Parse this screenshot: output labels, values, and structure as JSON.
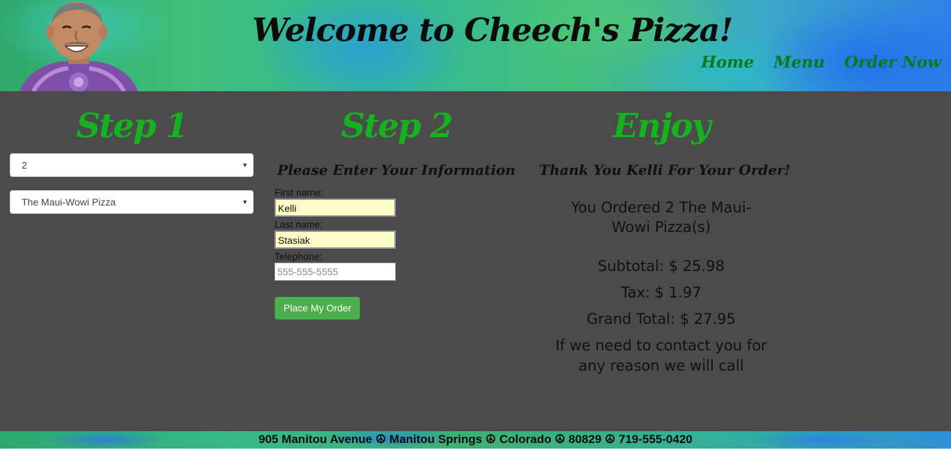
{
  "header": {
    "title": "Welcome to Cheech's Pizza!",
    "nav": {
      "home": "Home",
      "menu": "Menu",
      "order_now": "Order Now"
    }
  },
  "step1": {
    "heading": "Step 1",
    "quantity_value": "2",
    "pizza_value": "The Maui-Wowi Pizza"
  },
  "step2": {
    "heading": "Step 2",
    "subheading": "Please Enter Your Information",
    "first_name_label": "First name:",
    "first_name_value": "Kelli",
    "last_name_label": "Last name:",
    "last_name_value": "Stasiak",
    "telephone_label": "Telephone:",
    "telephone_placeholder": "555-555-5555",
    "button_label": "Place My Order"
  },
  "enjoy": {
    "heading": "Enjoy",
    "thanks": "Thank You Kelli For Your Order!",
    "ordered": "You Ordered 2 The Maui-Wowi Pizza(s)",
    "subtotal": "Subtotal: $ 25.98",
    "tax": "Tax: $ 1.97",
    "grand_total": "Grand Total: $ 27.95",
    "contact": "If we need to contact you for any reason we will call"
  },
  "footer": {
    "address": "905 Manitou Avenue ☮ Manitou Springs ☮ Colorado ☮ 80829 ☮ 719-555-0420"
  },
  "colors": {
    "accent_green": "#14b21e",
    "nav_green": "#0b7a1c",
    "panel_gray": "#4b4b4b",
    "button_green": "#4cae4c",
    "autofill_yellow": "#fbfcc6"
  },
  "icons": {
    "select_arrow": "dropdown-arrow-icon",
    "avatar": "chef-portrait"
  }
}
